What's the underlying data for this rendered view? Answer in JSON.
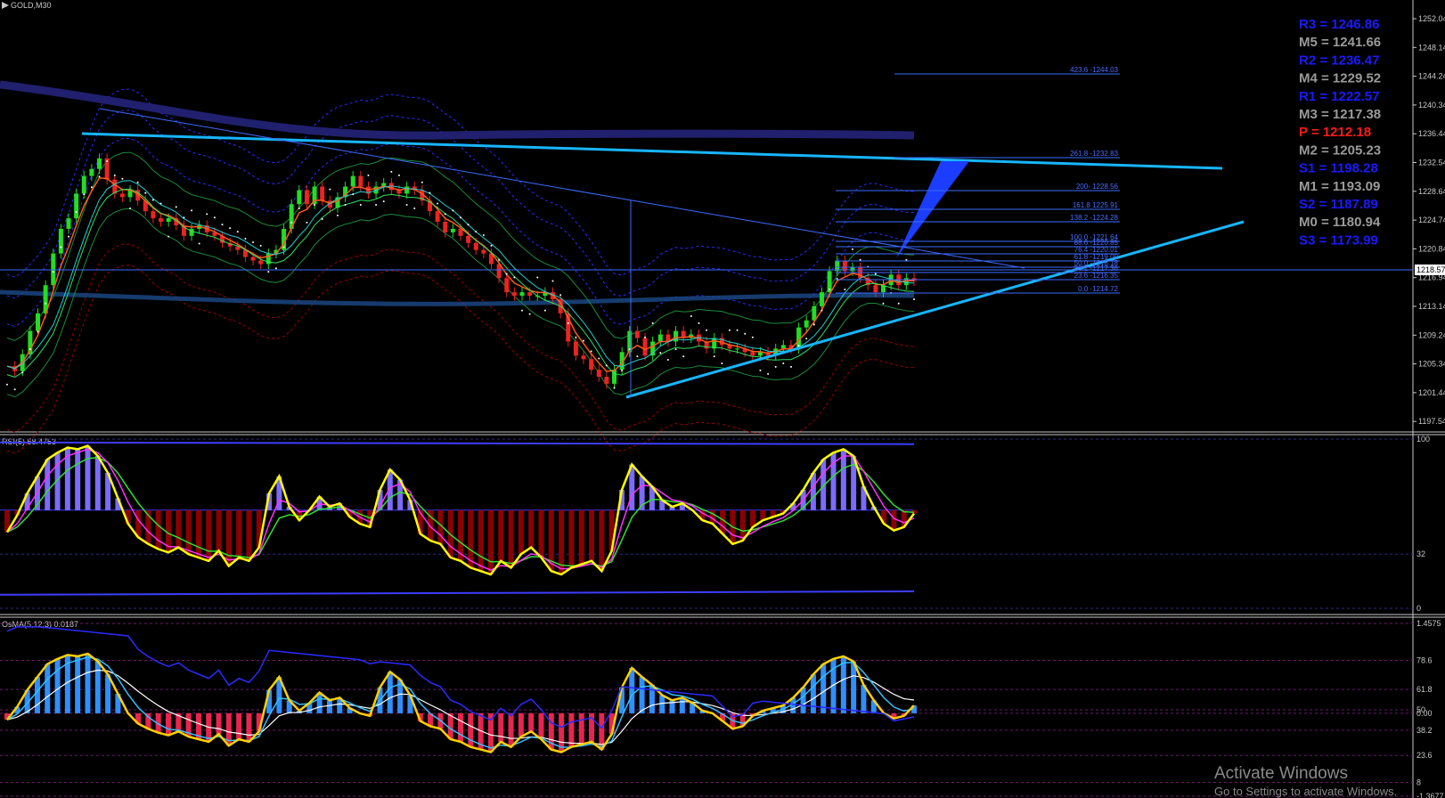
{
  "header": {
    "symbol": "GOLD,M30"
  },
  "colors": {
    "background": "#000000",
    "bull": "#22dd22",
    "bear": "#ee2222",
    "trendline": "#17b6ff",
    "pivot_blue": "#1a1aff",
    "pivot_gray": "#9a9a9a",
    "pivot_red": "#ff1a1a",
    "rsi_line": "#ffff00",
    "hist_pos": "#7b6bff",
    "hist_neg": "#8b0000",
    "osma_pos": "#2f8fff",
    "osma_neg": "#e8254f"
  },
  "pivots": [
    {
      "label": "R3 = 1246.86",
      "color": "blue"
    },
    {
      "label": "M5 = 1241.66",
      "color": "gray"
    },
    {
      "label": "R2 = 1236.47",
      "color": "blue"
    },
    {
      "label": "M4 = 1229.52",
      "color": "gray"
    },
    {
      "label": "R1 = 1222.57",
      "color": "blue"
    },
    {
      "label": "M3 = 1217.38",
      "color": "gray"
    },
    {
      "label": "P  = 1212.18",
      "color": "red"
    },
    {
      "label": "M2 = 1205.23",
      "color": "gray"
    },
    {
      "label": "S1 = 1198.28",
      "color": "blue"
    },
    {
      "label": "M1 = 1193.09",
      "color": "gray"
    },
    {
      "label": "S2 = 1187.89",
      "color": "blue"
    },
    {
      "label": "M0 = 1180.94",
      "color": "gray"
    },
    {
      "label": "S3 = 1173.99",
      "color": "blue"
    }
  ],
  "price_axis": {
    "ticks": [
      "1252.04",
      "1248.14",
      "1244.24",
      "1240.34",
      "1236.44",
      "1232.54",
      "1228.64",
      "1224.74",
      "1220.84",
      "1216.94",
      "1213.14",
      "1209.24",
      "1205.34",
      "1201.44",
      "1197.54"
    ],
    "current_price": "1218.57"
  },
  "fib_levels": [
    {
      "label": "423.6 -1244.03"
    },
    {
      "label": "261.8 -1232.83"
    },
    {
      "label": "200- 1228.56"
    },
    {
      "label": "161.8 1225.91"
    },
    {
      "label": "138.2 -1224.28"
    },
    {
      "label": "100.0 -1221.64"
    },
    {
      "label": "88.6 -1220.85"
    },
    {
      "label": "76.4 -1220.01"
    },
    {
      "label": "61.8 -1219.00"
    },
    {
      "label": "50.0 -1218.18"
    },
    {
      "label": "38.2 -1217.36"
    },
    {
      "label": "23.6 -1216.35"
    },
    {
      "label": "0.0 -1214.72"
    }
  ],
  "rsi_panel": {
    "title": "RSI(5) 58.4753",
    "ticks": [
      "100",
      "32",
      "0"
    ]
  },
  "osma_panel": {
    "title": "OsMA(5,12,3) 0.0187",
    "ticks": [
      "1.4575",
      "78.6",
      "61.8",
      "50",
      "0.00",
      "38.2",
      "23.6",
      "8",
      "-1.3677"
    ]
  },
  "watermark": {
    "line1": "Activate Windows",
    "line2": "Go to Settings to activate Windows."
  },
  "chart_data": {
    "type": "candlestick",
    "symbol": "GOLD",
    "timeframe": "M30",
    "ylim": [
      1197.54,
      1252.04
    ],
    "closes": [
      1206.5,
      1205.8,
      1208.2,
      1211.5,
      1214.0,
      1218.0,
      1222.5,
      1226.0,
      1227.5,
      1231.0,
      1233.5,
      1234.5,
      1236.0,
      1233.0,
      1231.0,
      1230.5,
      1231.5,
      1230.0,
      1228.5,
      1227.5,
      1227.0,
      1227.5,
      1226.5,
      1225.0,
      1226.0,
      1226.5,
      1225.5,
      1225.0,
      1224.0,
      1223.5,
      1223.0,
      1222.0,
      1221.5,
      1221.0,
      1222.5,
      1223.0,
      1226.0,
      1229.5,
      1231.5,
      1229.5,
      1232.0,
      1230.0,
      1229.0,
      1230.5,
      1232.0,
      1233.5,
      1232.0,
      1231.0,
      1232.0,
      1232.5,
      1231.5,
      1231.0,
      1232.0,
      1231.5,
      1230.0,
      1228.5,
      1227.0,
      1225.5,
      1226.0,
      1225.0,
      1224.0,
      1223.0,
      1222.5,
      1221.0,
      1219.0,
      1217.0,
      1216.5,
      1217.0,
      1216.5,
      1216.5,
      1217.0,
      1216.0,
      1214.0,
      1210.0,
      1208.0,
      1207.5,
      1206.0,
      1205.0,
      1204.0,
      1206.0,
      1208.5,
      1211.5,
      1210.5,
      1208.0,
      1210.0,
      1211.0,
      1210.0,
      1211.5,
      1210.5,
      1211.0,
      1210.0,
      1209.0,
      1210.5,
      1209.5,
      1209.0,
      1209.0,
      1208.5,
      1208.0,
      1208.5,
      1208.0,
      1209.0,
      1209.5,
      1209.0,
      1212.0,
      1213.0,
      1215.0,
      1217.0,
      1220.0,
      1221.5,
      1220.0,
      1220.5,
      1219.0,
      1218.0,
      1217.0,
      1218.0,
      1219.5,
      1218.0,
      1219.0,
      1218.6
    ],
    "rsi": [
      45,
      55,
      68,
      78,
      88,
      92,
      95,
      94,
      96,
      90,
      80,
      65,
      50,
      42,
      38,
      35,
      33,
      36,
      32,
      30,
      28,
      34,
      25,
      30,
      28,
      36,
      68,
      78,
      60,
      52,
      58,
      66,
      60,
      62,
      54,
      50,
      48,
      70,
      82,
      76,
      64,
      44,
      40,
      38,
      30,
      28,
      24,
      22,
      20,
      28,
      24,
      32,
      36,
      30,
      22,
      20,
      24,
      26,
      28,
      22,
      34,
      70,
      85,
      78,
      72,
      64,
      60,
      62,
      58,
      52,
      50,
      44,
      38,
      40,
      48,
      52,
      54,
      56,
      62,
      70,
      80,
      88,
      92,
      94,
      90,
      72,
      60,
      50,
      46,
      48,
      56
    ]
  }
}
